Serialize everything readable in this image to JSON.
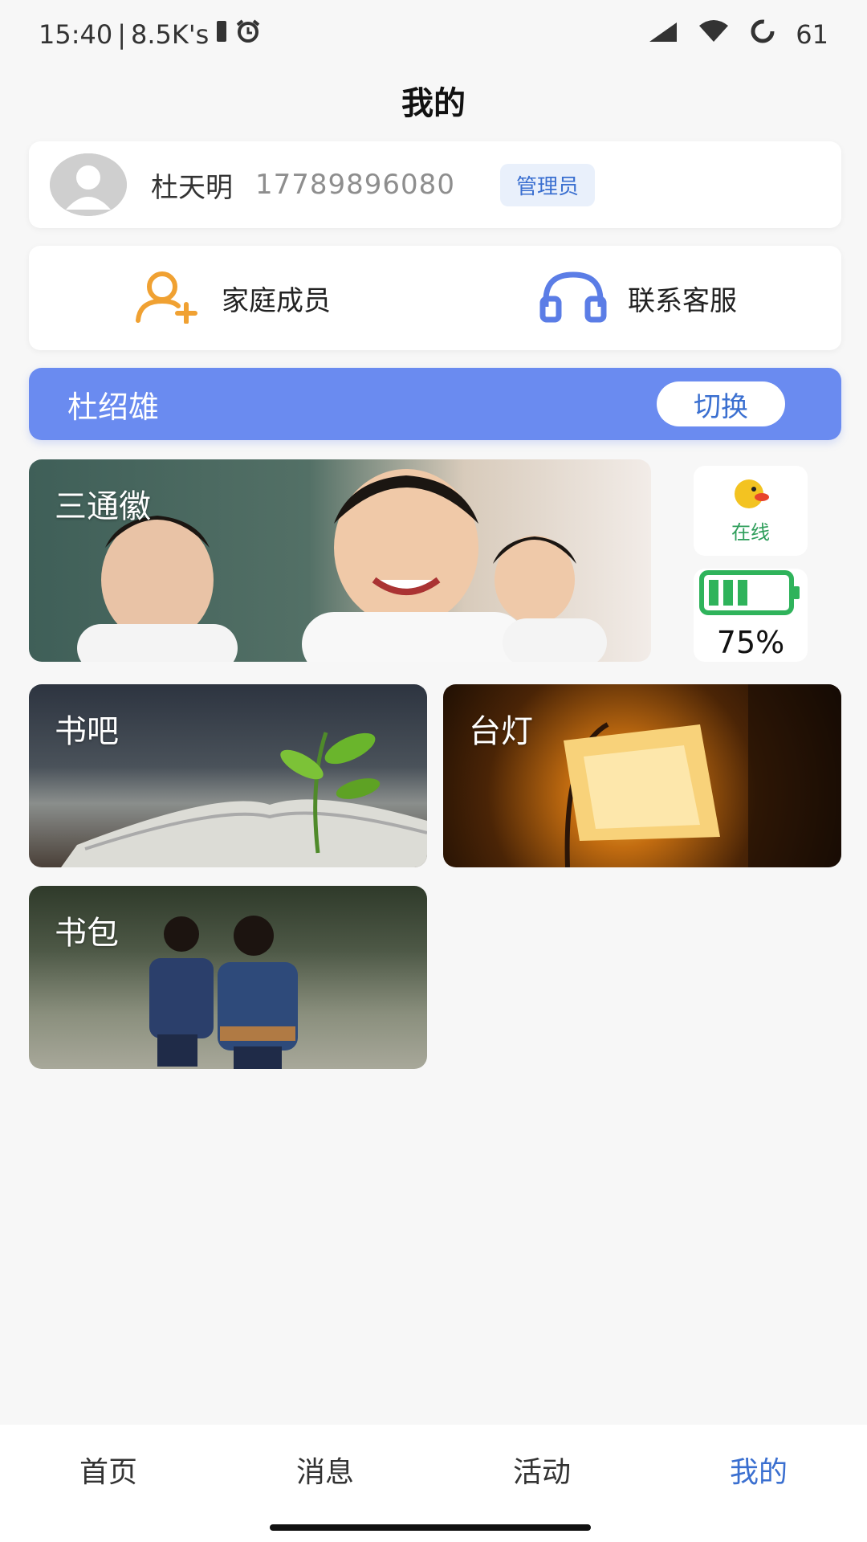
{
  "status_bar": {
    "time": "15:40",
    "speed": "8.5K's",
    "battery_level": "61",
    "icons": [
      "vibrate-icon",
      "alarm-icon",
      "signal-icon",
      "wifi-icon",
      "battery-ring-icon"
    ]
  },
  "header": {
    "title": "我的"
  },
  "profile": {
    "name": "杜天明",
    "phone": "17789896080",
    "role": "管理员"
  },
  "quick_actions": [
    {
      "label": "家庭成员",
      "icon": "add-user-icon",
      "color": "#f0a132"
    },
    {
      "label": "联系客服",
      "icon": "headset-icon",
      "color": "#5b7de6"
    }
  ],
  "switch_bar": {
    "student": "杜绍雄",
    "button": "切换"
  },
  "devices": {
    "school": "三通徽",
    "bookbar": "书吧",
    "lamp": "台灯",
    "bag": "书包"
  },
  "device_status": {
    "online": "在线",
    "battery": "75%",
    "battery_fraction": 0.75
  },
  "bottom_nav": [
    {
      "label": "首页",
      "active": false
    },
    {
      "label": "消息",
      "active": false
    },
    {
      "label": "活动",
      "active": false
    },
    {
      "label": "我的",
      "active": true
    }
  ],
  "colors": {
    "accent": "#6a8bf0",
    "active_tab": "#3a6fd0",
    "online": "#2f9e5b",
    "battery": "#2fb35b"
  }
}
